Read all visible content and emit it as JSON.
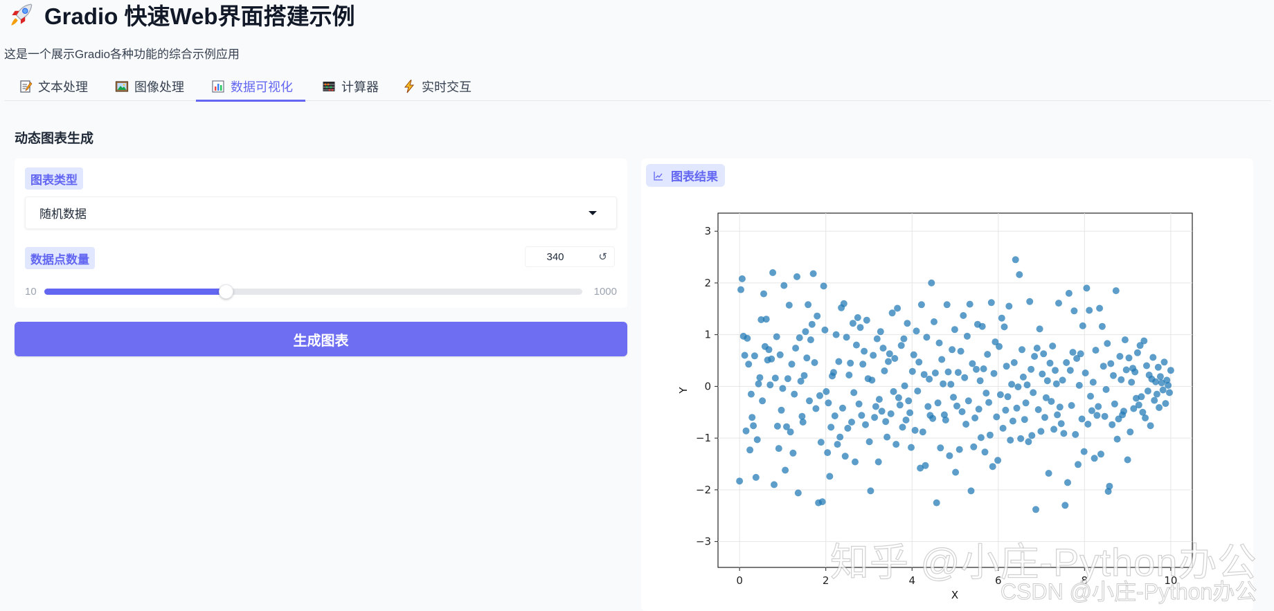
{
  "app": {
    "title": "Gradio 快速Web界面搭建示例",
    "subtitle": "这是一个展示Gradio各种功能的综合示例应用"
  },
  "tabs": [
    {
      "label": "文本处理",
      "icon": "memo-icon",
      "active": false
    },
    {
      "label": "图像处理",
      "icon": "picture-icon",
      "active": false
    },
    {
      "label": "数据可视化",
      "icon": "bar-chart-icon",
      "active": true
    },
    {
      "label": "计算器",
      "icon": "abacus-icon",
      "active": false
    },
    {
      "label": "实时交互",
      "icon": "lightning-icon",
      "active": false
    }
  ],
  "section": {
    "title": "动态图表生成"
  },
  "controls": {
    "chart_type_label": "图表类型",
    "chart_type_value": "随机数据",
    "points_label": "数据点数量",
    "points_value": "340",
    "slider_min": "10",
    "slider_max": "1000",
    "slider_value_fraction": 0.3374
  },
  "actions": {
    "generate_label": "生成图表"
  },
  "result": {
    "label": "图表结果"
  },
  "chart_data": {
    "type": "scatter",
    "title": "",
    "xlabel": "X",
    "ylabel": "Y",
    "xlim": [
      -0.5,
      10.5
    ],
    "ylim": [
      -3.5,
      3.35
    ],
    "x_ticks": [
      0,
      2,
      4,
      6,
      8,
      10
    ],
    "y_ticks": [
      -3,
      -2,
      -1,
      0,
      1,
      2,
      3
    ],
    "grid": true,
    "point_color": "#1f77b4",
    "num_points": 340,
    "x": [
      0.0,
      0.03,
      0.06,
      0.09,
      0.12,
      0.15,
      0.18,
      0.21,
      0.24,
      0.27,
      0.29,
      0.32,
      0.35,
      0.38,
      0.41,
      0.44,
      0.47,
      0.5,
      0.53,
      0.56,
      0.59,
      0.62,
      0.65,
      0.68,
      0.71,
      0.74,
      0.77,
      0.8,
      0.83,
      0.86,
      0.88,
      0.91,
      0.94,
      0.97,
      1.0,
      1.03,
      1.06,
      1.09,
      1.12,
      1.15,
      1.18,
      1.21,
      1.24,
      1.27,
      1.3,
      1.33,
      1.36,
      1.39,
      1.42,
      1.45,
      1.47,
      1.5,
      1.53,
      1.56,
      1.59,
      1.62,
      1.65,
      1.68,
      1.71,
      1.74,
      1.77,
      1.8,
      1.83,
      1.86,
      1.89,
      1.92,
      1.95,
      1.98,
      2.01,
      2.04,
      2.06,
      2.09,
      2.12,
      2.15,
      2.18,
      2.21,
      2.24,
      2.27,
      2.3,
      2.33,
      2.36,
      2.39,
      2.42,
      2.45,
      2.48,
      2.51,
      2.54,
      2.57,
      2.6,
      2.63,
      2.65,
      2.68,
      2.71,
      2.74,
      2.77,
      2.8,
      2.83,
      2.86,
      2.89,
      2.92,
      2.95,
      2.98,
      3.01,
      3.04,
      3.07,
      3.1,
      3.13,
      3.16,
      3.19,
      3.22,
      3.24,
      3.27,
      3.3,
      3.33,
      3.36,
      3.39,
      3.42,
      3.45,
      3.48,
      3.51,
      3.54,
      3.57,
      3.6,
      3.63,
      3.66,
      3.69,
      3.72,
      3.75,
      3.78,
      3.81,
      3.83,
      3.86,
      3.89,
      3.92,
      3.95,
      3.98,
      4.01,
      4.04,
      4.07,
      4.1,
      4.13,
      4.16,
      4.19,
      4.22,
      4.25,
      4.28,
      4.31,
      4.34,
      4.37,
      4.4,
      4.42,
      4.45,
      4.48,
      4.51,
      4.54,
      4.57,
      4.6,
      4.63,
      4.66,
      4.69,
      4.72,
      4.75,
      4.78,
      4.81,
      4.84,
      4.87,
      4.9,
      4.93,
      4.96,
      4.99,
      5.01,
      5.04,
      5.07,
      5.1,
      5.13,
      5.16,
      5.19,
      5.22,
      5.25,
      5.28,
      5.31,
      5.34,
      5.37,
      5.4,
      5.43,
      5.46,
      5.49,
      5.52,
      5.55,
      5.58,
      5.6,
      5.63,
      5.66,
      5.69,
      5.72,
      5.75,
      5.78,
      5.81,
      5.84,
      5.87,
      5.9,
      5.93,
      5.96,
      5.99,
      6.02,
      6.05,
      6.08,
      6.11,
      6.14,
      6.17,
      6.19,
      6.22,
      6.25,
      6.28,
      6.31,
      6.34,
      6.37,
      6.4,
      6.43,
      6.46,
      6.49,
      6.52,
      6.55,
      6.58,
      6.61,
      6.64,
      6.67,
      6.7,
      6.73,
      6.76,
      6.78,
      6.81,
      6.84,
      6.87,
      6.9,
      6.93,
      6.96,
      6.99,
      7.02,
      7.05,
      7.08,
      7.11,
      7.14,
      7.17,
      7.2,
      7.23,
      7.26,
      7.29,
      7.32,
      7.35,
      7.37,
      7.4,
      7.43,
      7.46,
      7.49,
      7.52,
      7.55,
      7.58,
      7.61,
      7.64,
      7.67,
      7.7,
      7.73,
      7.76,
      7.79,
      7.82,
      7.85,
      7.88,
      7.91,
      7.94,
      7.96,
      7.99,
      8.02,
      8.05,
      8.08,
      8.11,
      8.14,
      8.17,
      8.2,
      8.23,
      8.26,
      8.29,
      8.32,
      8.35,
      8.38,
      8.41,
      8.44,
      8.47,
      8.5,
      8.53,
      8.55,
      8.58,
      8.61,
      8.64,
      8.67,
      8.7,
      8.73,
      8.76,
      8.79,
      8.82,
      8.85,
      8.88,
      8.91,
      8.94,
      8.97,
      9.0,
      9.03,
      9.06,
      9.09,
      9.12,
      9.14,
      9.17,
      9.2,
      9.23,
      9.26,
      9.29,
      9.32,
      9.35,
      9.38,
      9.41,
      9.44,
      9.47,
      9.5,
      9.53,
      9.56,
      9.59,
      9.62,
      9.65,
      9.68,
      9.71,
      9.73,
      9.76,
      9.79,
      9.82,
      9.85,
      9.88,
      9.91,
      9.94,
      9.97,
      10.0
    ],
    "y": [
      -1.83,
      1.87,
      2.08,
      0.97,
      0.6,
      -0.86,
      0.93,
      0.43,
      -1.23,
      -0.15,
      -0.6,
      -0.76,
      0.59,
      -1.76,
      -1.03,
      0.05,
      0.17,
      1.29,
      -0.28,
      1.79,
      0.77,
      1.3,
      0.51,
      0.71,
      0.03,
      0.53,
      2.2,
      -1.9,
      0.16,
      0.96,
      -0.77,
      -1.2,
      0.61,
      -0.46,
      -0.04,
      1.95,
      -1.62,
      -0.78,
      0.15,
      1.57,
      -0.88,
      0.43,
      -1.29,
      -0.15,
      0.74,
      2.12,
      -2.06,
      0.94,
      0.1,
      -0.58,
      -0.69,
      0.21,
      1.06,
      0.55,
      1.58,
      -0.28,
      0.9,
      1.2,
      2.18,
      0.46,
      -0.43,
      1.36,
      -2.25,
      -0.18,
      -1.08,
      -2.23,
      1.94,
      1.09,
      -0.1,
      -1.28,
      -0.32,
      -1.74,
      -0.79,
      0.2,
      0.27,
      -0.57,
      1.0,
      -1.12,
      0.48,
      -0.98,
      1.52,
      -0.42,
      1.6,
      -1.35,
      0.95,
      -0.81,
      0.22,
      0.45,
      -0.69,
      1.22,
      -0.12,
      -1.46,
      0.8,
      1.33,
      -0.34,
      1.14,
      -0.56,
      0.43,
      0.68,
      -0.74,
      1.28,
      0.15,
      -1.07,
      -2.02,
      0.12,
      0.6,
      -0.6,
      -0.39,
      0.92,
      -1.46,
      -0.25,
      1.06,
      -0.48,
      0.74,
      0.3,
      -0.68,
      -0.98,
      0.48,
      0.63,
      -0.53,
      1.42,
      -0.1,
      0.54,
      -1.12,
      1.51,
      -0.22,
      -0.36,
      0.79,
      -0.79,
      0.92,
      0.01,
      -0.65,
      1.22,
      -0.28,
      -0.51,
      -1.18,
      0.29,
      0.61,
      -0.85,
      1.07,
      -0.09,
      0.47,
      -1.58,
      1.58,
      -0.88,
      0.23,
      -1.53,
      0.95,
      -0.39,
      0.14,
      -0.56,
      2.0,
      -0.62,
      1.25,
      0.26,
      -2.25,
      -0.32,
      0.84,
      -1.19,
      0.52,
      0.05,
      -0.55,
      -0.65,
      1.58,
      0.28,
      -1.34,
      0.04,
      0.71,
      -0.21,
      1.1,
      -1.66,
      -0.38,
      0.27,
      -1.22,
      0.68,
      -0.49,
      1.37,
      0.17,
      -0.73,
      0.97,
      -0.28,
      1.59,
      -2.02,
      0.44,
      -1.17,
      -0.61,
      0.33,
      1.2,
      -0.44,
      0.11,
      -0.99,
      1.16,
      0.34,
      -1.27,
      -0.13,
      0.62,
      -0.31,
      -0.94,
      1.62,
      -1.55,
      0.25,
      0.86,
      -0.59,
      -1.43,
      0.77,
      -0.16,
      1.32,
      -0.81,
      1.15,
      -0.46,
      0.39,
      -0.2,
      1.55,
      -1.04,
      0.04,
      -0.67,
      0.46,
      2.45,
      -0.42,
      -0.01,
      2.16,
      -1.01,
      0.71,
      0.18,
      -0.64,
      -0.32,
      0.03,
      -1.07,
      1.64,
      0.33,
      -0.95,
      -0.12,
      0.58,
      -2.38,
      0.74,
      -0.45,
      1.11,
      -0.87,
      0.24,
      0.63,
      -0.6,
      -0.22,
      0.11,
      -1.68,
      0.45,
      -0.29,
      0.78,
      -0.83,
      0.31,
      0.05,
      -0.55,
      1.61,
      -0.4,
      -0.72,
      0.12,
      -0.91,
      -2.3,
      0.46,
      -1.86,
      1.8,
      0.31,
      -0.37,
      0.66,
      1.46,
      -0.93,
      0.54,
      -1.51,
      0.02,
      0.63,
      -0.63,
      1.17,
      -1.26,
      0.26,
      1.9,
      -0.73,
      1.47,
      -0.19,
      -0.47,
      0.08,
      -1.39,
      0.7,
      -0.56,
      -0.39,
      1.51,
      -1.31,
      1.16,
      0.39,
      -0.58,
      -0.06,
      0.83,
      -2.03,
      -1.93,
      0.44,
      -0.74,
      0.21,
      -0.34,
      1.85,
      -1.02,
      -0.63,
      0.58,
      0.13,
      -0.55,
      -0.48,
      0.9,
      0.32,
      -1.42,
      0.55,
      -0.88,
      0.08,
      0.35,
      -0.43,
      0.28,
      -0.23,
      0.65,
      -0.36,
      0.79,
      -0.2,
      -0.5,
      0.88,
      -0.61,
      0.4,
      -0.09,
      0.22,
      -0.76,
      0.14,
      0.56,
      -0.27,
      0.09,
      -0.15,
      0.37,
      -0.41,
      0.19,
      0.07,
      -0.07,
      0.47,
      -0.33,
      0.12,
      0.02,
      -0.12,
      0.31,
      0.09
    ]
  },
  "watermark": {
    "main": "知乎 @小庄-Python办公",
    "footer": "CSDN @小庄-Python办公"
  }
}
